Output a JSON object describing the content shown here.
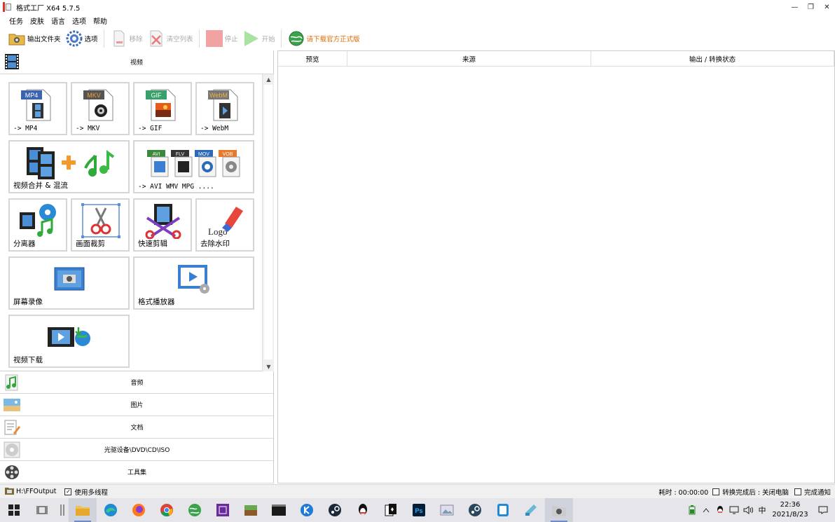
{
  "window": {
    "title": "格式工厂 X64 5.7.5",
    "controls": [
      "—",
      "❐",
      "✕"
    ]
  },
  "menu": [
    "任务",
    "皮肤",
    "语言",
    "选项",
    "帮助"
  ],
  "toolbar": {
    "output_folder": "输出文件夹",
    "options": "选项",
    "remove": "移除",
    "clear_list": "清空列表",
    "stop": "停止",
    "start": "开始",
    "download_official": "请下载官方正式版"
  },
  "categories": {
    "video": "视频",
    "audio": "音频",
    "image": "图片",
    "document": "文档",
    "disc": "光驱设备\\DVD\\CD\\ISO",
    "tools": "工具集"
  },
  "tiles": {
    "mp4": "-> MP4",
    "mkv": "-> MKV",
    "gif": "-> GIF",
    "webm": "-> WebM",
    "merge": "视频合并 & 混流",
    "multi": "-> AVI WMV MPG ....",
    "splitter": "分离器",
    "crop": "画面裁剪",
    "quick_cut": "快速剪辑",
    "remove_logo": "去除水印",
    "screen_record": "屏幕录像",
    "player": "格式播放器",
    "download": "视频下载"
  },
  "badges": {
    "mp4": "MP4",
    "mkv": "MKV",
    "gif": "GIF",
    "webm": "WebM",
    "avi": "AVI",
    "flv": "FLV",
    "mov": "MOV",
    "vob": "VOB",
    "logo": "Logo"
  },
  "table": {
    "columns": [
      "预览",
      "来源",
      "输出 / 转换状态"
    ]
  },
  "status": {
    "output_path": "H:\\FFOutput",
    "multithread": "使用多线程",
    "elapsed": "耗时 : 00:00:00",
    "after_convert": "转换完成后 : 关闭电脑",
    "notify": "完成通知"
  },
  "taskbar": {
    "ime": "中",
    "time": "22:36",
    "date": "2021/8/23"
  },
  "colors": {
    "accent_orange": "#e06a00",
    "tile_border": "#d6d6d6",
    "statusbar_bg": "#f0f0f0",
    "taskbar_bg": "#e6e6ea"
  }
}
